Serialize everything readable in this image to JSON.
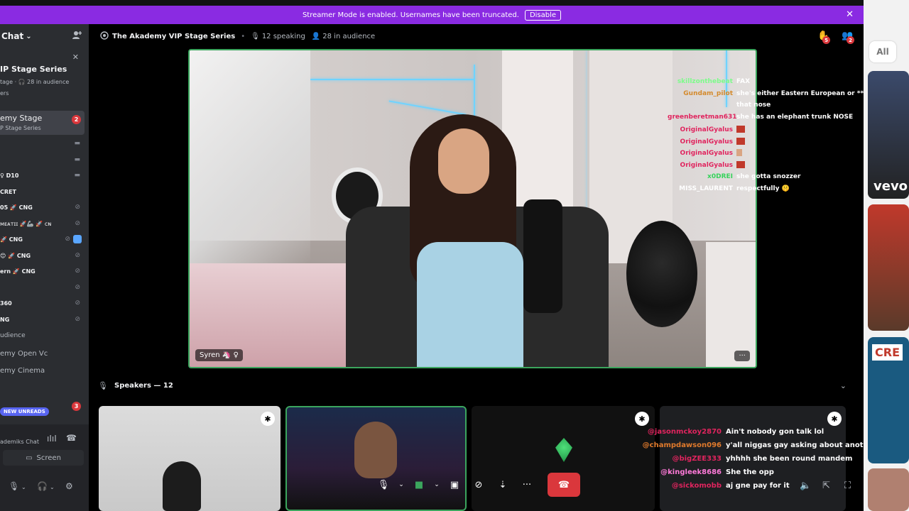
{
  "banner": {
    "text": "Streamer Mode is enabled. Usernames have been truncated.",
    "button": "Disable",
    "close": "✕"
  },
  "sidebar": {
    "header": "Chat",
    "header_chevron": "⌄",
    "title": "IP Stage Series",
    "subtitle": "tage · 🎧 28 in audience",
    "subtitle2": "ers",
    "active_item": {
      "label": "emy Stage",
      "sub": "P Stage Series",
      "badge": "2"
    },
    "rows": [
      {
        "label": "D10",
        "icon": "📹"
      },
      {
        "label": "CRET",
        "icon": ""
      },
      {
        "label": "05 🚀 CNG",
        "icon": ""
      },
      {
        "label": "ᴍᴇᴀᴛɪɪ 🚀🦾 🚀 ᴄɴ",
        "icon": ""
      },
      {
        "label": "🚀 CNG",
        "icon": ""
      },
      {
        "label": "😊 🚀 CNG",
        "icon": ""
      },
      {
        "label": "ern 🚀 CNG",
        "icon": ""
      },
      {
        "label": "360",
        "icon": ""
      },
      {
        "label": "NG",
        "icon": ""
      }
    ],
    "audience_label": "udience",
    "channels": [
      "emy Open Vc",
      "emy Cinema"
    ],
    "new_unreads": "NEW UNREADS",
    "unread_badge": "3",
    "voice_label": "ademiks Chat",
    "screen_button": "Screen"
  },
  "header": {
    "title": "The Akademy VIP Stage Series",
    "speaking": "12 speaking",
    "audience": "28 in audience",
    "raise_badge": "5",
    "invite_badge": "2"
  },
  "stage": {
    "name_tag": "Syren 🦄 ♀",
    "more": "···"
  },
  "stream_chat": [
    {
      "user": "skillzonthebeat",
      "color": "#7cfc8a",
      "msg": "FAX"
    },
    {
      "user": "Gundam_pilot",
      "color": "#d48a2c",
      "msg": "she's either Eastern European or ****** with"
    },
    {
      "user": "",
      "color": "#ffffff",
      "msg": "that nose"
    },
    {
      "user": "greenberetman631",
      "color": "#e0245e",
      "msg": "she has an elephant trunk NOSE"
    },
    {
      "user": "OriginalGyalus",
      "color": "#e0245e",
      "msg": ""
    },
    {
      "user": "OriginalGyalus",
      "color": "#e0245e",
      "msg": ""
    },
    {
      "user": "OriginalGyalus",
      "color": "#e0245e",
      "msg": ""
    },
    {
      "user": "OriginalGyalus",
      "color": "#e0245e",
      "msg": ""
    },
    {
      "user": "x0DREI",
      "color": "#36d35b",
      "msg": "she gotta snozzer"
    },
    {
      "user": "MISS_LAURENT",
      "color": "#ffffff",
      "msg": "respectfully 🤫"
    }
  ],
  "speakers": {
    "label": "Speakers — 12"
  },
  "chat2": [
    {
      "user": "@jasonmckoy2870",
      "color": "#e0245e",
      "msg": "Ain't nobody gon talk lol"
    },
    {
      "user": "@champdawson096",
      "color": "#e07a2c",
      "msg": "y'all niggas gay asking about another nigga"
    },
    {
      "user": "@bigZEE333",
      "color": "#e0245e",
      "msg": "yhhhh she been round mandem"
    },
    {
      "user": "@kingleek8686",
      "color": "#ff7ad9",
      "msg": "She the opp"
    },
    {
      "user": "@sickomobb",
      "color": "#e0245e",
      "msg": "aj gne pay for it"
    }
  ],
  "right_panel": {
    "chip": "All",
    "vevo": "vevo",
    "cre": "CRE"
  }
}
